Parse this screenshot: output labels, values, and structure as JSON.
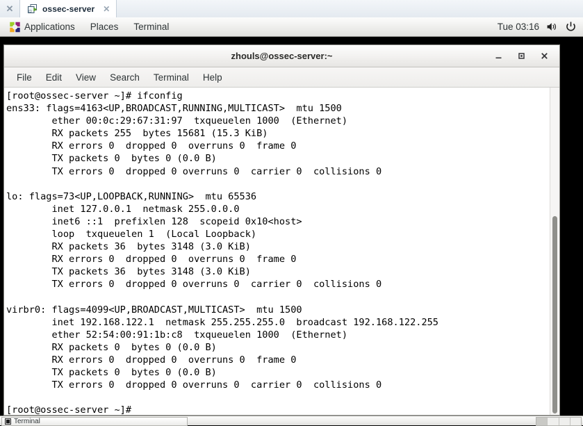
{
  "vm_tabstrip": {
    "strip_close_label": "✕",
    "tab": {
      "title": "ossec-server",
      "icon": "vm-console-icon",
      "close_label": "✕"
    }
  },
  "gnome_panel": {
    "menus": [
      {
        "label": "Applications",
        "icon": "centos-logo-icon"
      },
      {
        "label": "Places",
        "icon": ""
      },
      {
        "label": "Terminal",
        "icon": ""
      }
    ],
    "clock": "Tue 03:16",
    "volume_icon": "speaker-icon",
    "power_icon": "power-icon"
  },
  "terminal_window": {
    "title": "zhouls@ossec-server:~",
    "window_buttons": {
      "minimize": "minimize-icon",
      "maximize": "maximize-icon",
      "close": "close-icon"
    },
    "menubar": [
      "File",
      "Edit",
      "View",
      "Search",
      "Terminal",
      "Help"
    ],
    "lines": [
      "[root@ossec-server ~]# ifconfig",
      "ens33: flags=4163<UP,BROADCAST,RUNNING,MULTICAST>  mtu 1500",
      "        ether 00:0c:29:67:31:97  txqueuelen 1000  (Ethernet)",
      "        RX packets 255  bytes 15681 (15.3 KiB)",
      "        RX errors 0  dropped 0  overruns 0  frame 0",
      "        TX packets 0  bytes 0 (0.0 B)",
      "        TX errors 0  dropped 0 overruns 0  carrier 0  collisions 0",
      "",
      "lo: flags=73<UP,LOOPBACK,RUNNING>  mtu 65536",
      "        inet 127.0.0.1  netmask 255.0.0.0",
      "        inet6 ::1  prefixlen 128  scopeid 0x10<host>",
      "        loop  txqueuelen 1  (Local Loopback)",
      "        RX packets 36  bytes 3148 (3.0 KiB)",
      "        RX errors 0  dropped 0  overruns 0  frame 0",
      "        TX packets 36  bytes 3148 (3.0 KiB)",
      "        TX errors 0  dropped 0 overruns 0  carrier 0  collisions 0",
      "",
      "virbr0: flags=4099<UP,BROADCAST,MULTICAST>  mtu 1500",
      "        inet 192.168.122.1  netmask 255.255.255.0  broadcast 192.168.122.255",
      "        ether 52:54:00:91:1b:c8  txqueuelen 1000  (Ethernet)",
      "        RX packets 0  bytes 0 (0.0 B)",
      "        RX errors 0  dropped 0  overruns 0  frame 0",
      "        TX packets 0  bytes 0 (0.0 B)",
      "        TX errors 0  dropped 0 overruns 0  carrier 0  collisions 0",
      "",
      "[root@ossec-server ~]#"
    ],
    "scrollbar": {
      "name": "vertical-scrollbar"
    }
  },
  "gnome_bottom_panel": {
    "window_list_item": {
      "label": "Terminal",
      "icon": "terminal-icon"
    },
    "workspaces": [
      {
        "active": true
      },
      {
        "active": false
      },
      {
        "active": false
      },
      {
        "active": false
      }
    ]
  },
  "colors": {
    "desktop_background": "#000000",
    "terminal_background": "#ffffff",
    "terminal_foreground": "#000000",
    "panel_background": "#eeeeec",
    "tab_accent": "#1c2b3a"
  }
}
